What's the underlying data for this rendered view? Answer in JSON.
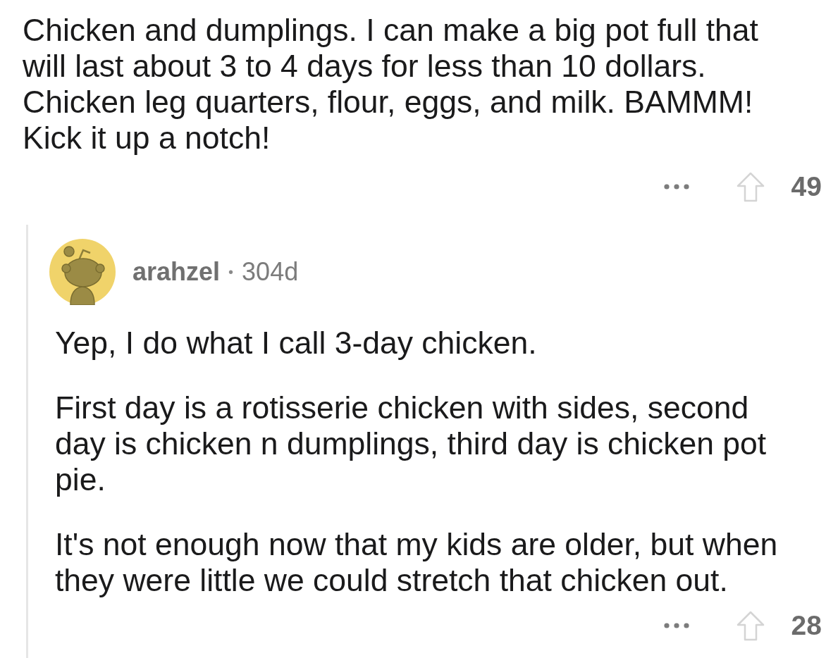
{
  "comment": {
    "body": "Chicken and dumplings. I can make a big pot full that\nwill last about 3 to 4 days for less than 10 dollars.\nChicken leg quarters, flour, eggs, and milk. BAMMM!\nKick it up a notch!",
    "score": "49"
  },
  "reply": {
    "author": "arahzel",
    "separator": "•",
    "age": "304d",
    "paragraphs": [
      "Yep, I do what I call 3-day chicken.",
      "First day is a rotisserie chicken with sides, second\nday is chicken n dumplings, third day is chicken pot\npie.",
      "It's not enough now that my kids are older, but when\nthey were little we could stretch that chicken out."
    ],
    "score": "28"
  }
}
